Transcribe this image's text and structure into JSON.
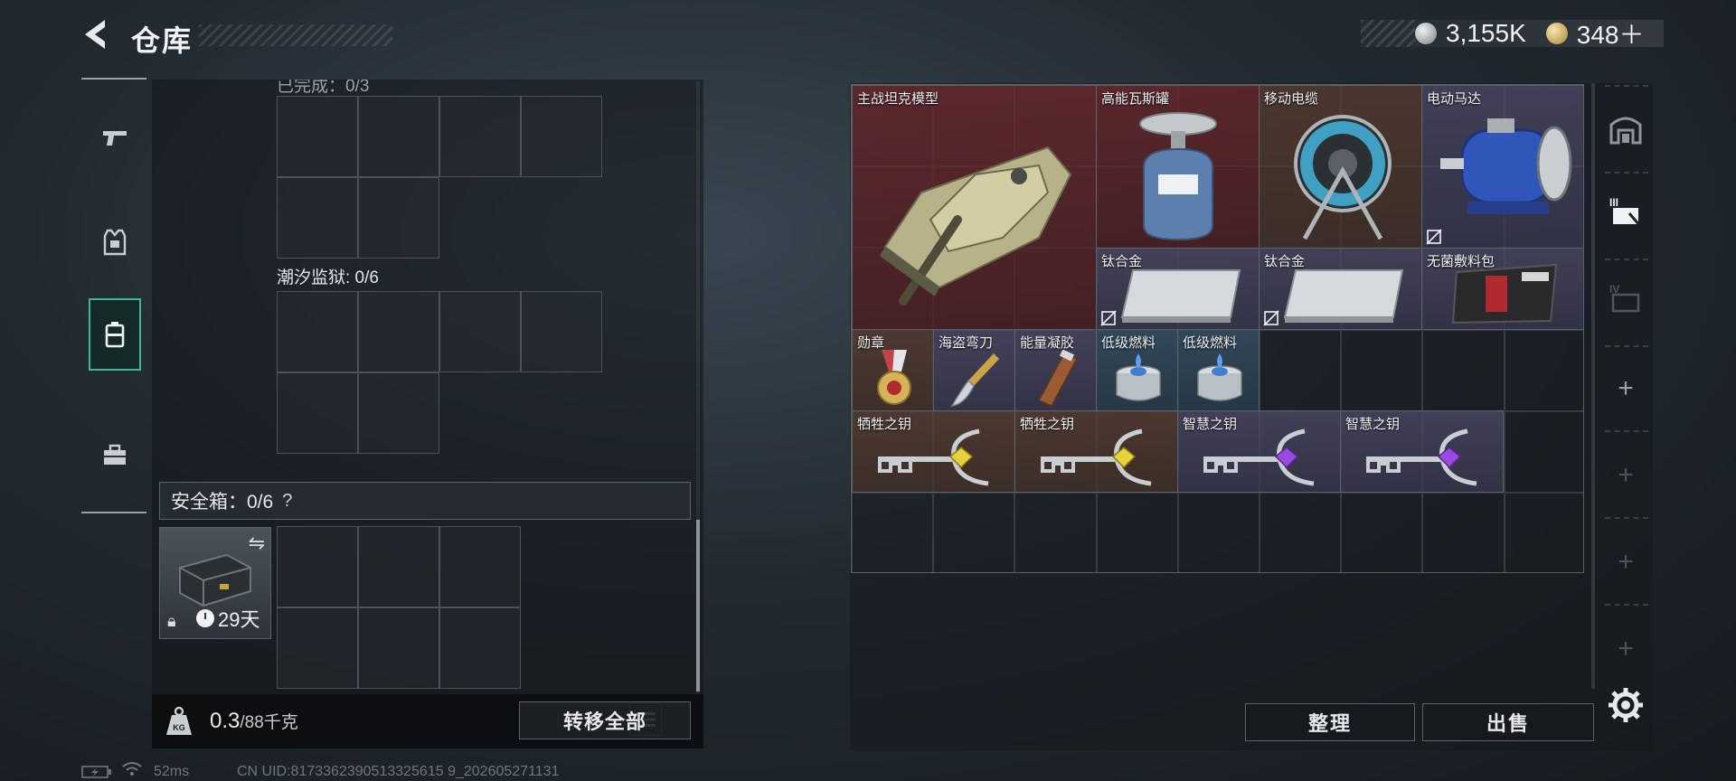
{
  "header": {
    "title": "仓库",
    "currency": [
      {
        "icon": "silver-coin-icon",
        "value": "3,155K"
      },
      {
        "icon": "gold-coin-icon",
        "value": "348＋"
      }
    ]
  },
  "left": {
    "cutoff_label": "已完成：0/3",
    "tidal_prison_label": "潮汐监狱: 0/6",
    "safe_box_label": "安全箱：0/6",
    "help": "?",
    "safe_box_timer": "29天",
    "weight_value": "0.3",
    "weight_max": "/88千克",
    "transfer_all": "转移全部"
  },
  "storage": {
    "items": [
      {
        "name": "主战坦克模型",
        "icon": "tank-model-icon"
      },
      {
        "name": "高能瓦斯罐",
        "icon": "gas-canister-icon"
      },
      {
        "name": "移动电缆",
        "icon": "cable-reel-icon"
      },
      {
        "name": "电动马达",
        "icon": "electric-motor-icon"
      },
      {
        "name": "钛合金",
        "icon": "titanium-alloy-icon"
      },
      {
        "name": "钛合金",
        "icon": "titanium-alloy-icon"
      },
      {
        "name": "无菌敷料包",
        "icon": "sterile-dressing-icon"
      },
      {
        "name": "勋章",
        "icon": "medal-icon"
      },
      {
        "name": "海盗弯刀",
        "icon": "pirate-knife-icon"
      },
      {
        "name": "能量凝胶",
        "icon": "energy-gel-icon"
      },
      {
        "name": "低级燃料",
        "icon": "fuel-can-icon"
      },
      {
        "name": "低级燃料",
        "icon": "fuel-can-icon"
      },
      {
        "name": "牺牲之钥",
        "icon": "key-yellow-icon"
      },
      {
        "name": "牺牲之钥",
        "icon": "key-yellow-icon"
      },
      {
        "name": "智慧之钥",
        "icon": "key-purple-icon"
      },
      {
        "name": "智慧之钥",
        "icon": "key-purple-icon"
      }
    ],
    "sort_label": "整理",
    "sell_label": "出售"
  },
  "status_bar": {
    "ping": "52ms",
    "uid": "CN UID:8173362390513325615 9_202605271131"
  }
}
